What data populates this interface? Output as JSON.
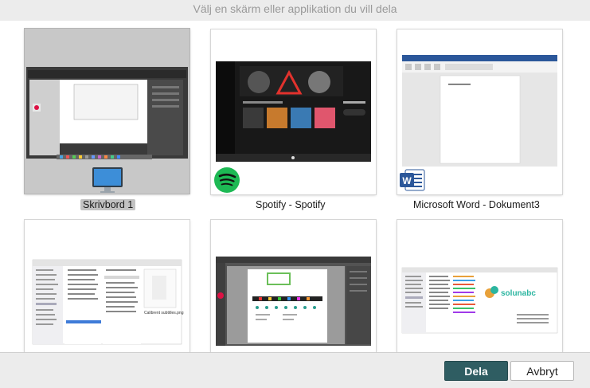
{
  "dialog": {
    "title": "Välj en skärm eller applikation du vill dela"
  },
  "sources": [
    {
      "label": "Skrivbord 1",
      "icon": "monitor-icon",
      "selected": true
    },
    {
      "label": "Spotify - Spotify",
      "icon": "spotify-icon",
      "selected": false
    },
    {
      "label": "Microsoft Word - Dokument3",
      "icon": "word-icon",
      "selected": false
    },
    {
      "label": "",
      "icon": "",
      "selected": false
    },
    {
      "label": "",
      "icon": "",
      "selected": false
    },
    {
      "label": "",
      "icon": "",
      "selected": false
    }
  ],
  "thumb_texts": {
    "finder_caption": "Calibrent subtitles.png",
    "brand": "solunabc"
  },
  "icons": {
    "spotify_letter": "",
    "word_letter": "W"
  },
  "buttons": {
    "share": "Dela",
    "cancel": "Avbryt"
  },
  "colors": {
    "accent": "#2f5d62",
    "selected_bg": "#c8c8c8",
    "spotify_green": "#1db954",
    "word_blue": "#2b579a"
  }
}
